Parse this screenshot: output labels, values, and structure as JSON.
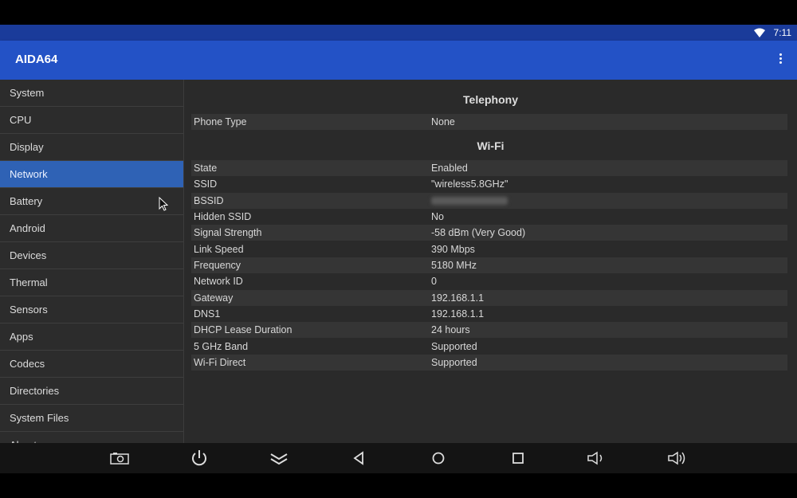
{
  "status": {
    "time": "7:11"
  },
  "app": {
    "title": "AIDA64"
  },
  "sidebar": {
    "items": [
      {
        "label": "System"
      },
      {
        "label": "CPU"
      },
      {
        "label": "Display"
      },
      {
        "label": "Network",
        "active": true
      },
      {
        "label": "Battery"
      },
      {
        "label": "Android"
      },
      {
        "label": "Devices"
      },
      {
        "label": "Thermal"
      },
      {
        "label": "Sensors"
      },
      {
        "label": "Apps"
      },
      {
        "label": "Codecs"
      },
      {
        "label": "Directories"
      },
      {
        "label": "System Files"
      },
      {
        "label": "About"
      }
    ]
  },
  "telephony": {
    "title": "Telephony",
    "rows": [
      {
        "key": "Phone Type",
        "value": "None"
      }
    ]
  },
  "wifi": {
    "title": "Wi-Fi",
    "rows": [
      {
        "key": "State",
        "value": "Enabled"
      },
      {
        "key": "SSID",
        "value": "\"wireless5.8GHz\""
      },
      {
        "key": "BSSID",
        "value": "",
        "blurred": true
      },
      {
        "key": "Hidden SSID",
        "value": "No"
      },
      {
        "key": "Signal Strength",
        "value": "-58 dBm (Very Good)"
      },
      {
        "key": "Link Speed",
        "value": "390 Mbps"
      },
      {
        "key": "Frequency",
        "value": "5180 MHz"
      },
      {
        "key": "Network ID",
        "value": "0"
      },
      {
        "key": "Gateway",
        "value": "192.168.1.1"
      },
      {
        "key": "DNS1",
        "value": "192.168.1.1"
      },
      {
        "key": "DHCP Lease Duration",
        "value": "24 hours"
      },
      {
        "key": "5 GHz Band",
        "value": "Supported"
      },
      {
        "key": "Wi-Fi Direct",
        "value": "Supported"
      }
    ]
  },
  "navbar": {
    "icons": [
      "screenshot-icon",
      "power-icon",
      "collapse-icon",
      "back-icon",
      "home-icon",
      "recents-icon",
      "volume-down-icon",
      "volume-up-icon"
    ]
  },
  "colors": {
    "appbar": "#2352c6",
    "statusbar": "#1a3b9a",
    "active": "#2f62b5"
  }
}
